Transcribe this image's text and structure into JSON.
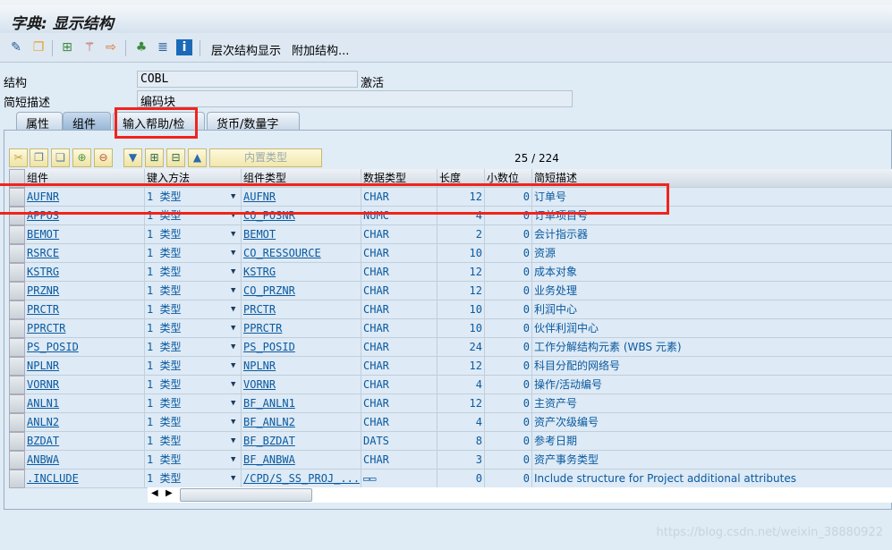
{
  "window": {
    "title": "字典: 显示结构"
  },
  "toolbar": {
    "items": [
      {
        "icon": "glasses-pencil-icon"
      },
      {
        "icon": "toggle-display-change-icon"
      },
      {
        "icon": "where-used-icon"
      },
      {
        "icon": "magic-wand-icon"
      },
      {
        "icon": "transport-icon"
      },
      {
        "icon": "hierarchy-icon"
      },
      {
        "icon": "align-icon"
      },
      {
        "icon": "info-icon"
      }
    ],
    "hierarchy_label": "层次结构显示",
    "append_label": "附加结构..."
  },
  "fields": {
    "structure_label": "结构",
    "structure_value": "COBL",
    "status": "激活",
    "desc_label": "简短描述",
    "desc_value": "编码块"
  },
  "tabs": [
    {
      "label": "属性"
    },
    {
      "label": "组件",
      "active": true
    },
    {
      "label": "输入帮助/检查"
    },
    {
      "label": "货币/数量字段"
    }
  ],
  "grid_toolbar": {
    "builtin_label": "内置类型",
    "counter": "25  /  224"
  },
  "columns": [
    "组件",
    "键入方法",
    "组件类型",
    "数据类型",
    "长度",
    "小数位",
    "简短描述"
  ],
  "rows": [
    {
      "name": "AUFNR",
      "method": "1 类型",
      "type": "AUFNR",
      "dtype": "CHAR",
      "len": "12",
      "dec": "0",
      "desc": "订单号"
    },
    {
      "name": "APPOS",
      "method": "1 类型",
      "type": "CO_POSNR",
      "dtype": "NUMC",
      "len": "4",
      "dec": "0",
      "desc": "订单项目号"
    },
    {
      "name": "BEMOT",
      "method": "1 类型",
      "type": "BEMOT",
      "dtype": "CHAR",
      "len": "2",
      "dec": "0",
      "desc": "会计指示器"
    },
    {
      "name": "RSRCE",
      "method": "1 类型",
      "type": "CO_RESSOURCE",
      "dtype": "CHAR",
      "len": "10",
      "dec": "0",
      "desc": "资源"
    },
    {
      "name": "KSTRG",
      "method": "1 类型",
      "type": "KSTRG",
      "dtype": "CHAR",
      "len": "12",
      "dec": "0",
      "desc": "成本对象"
    },
    {
      "name": "PRZNR",
      "method": "1 类型",
      "type": "CO_PRZNR",
      "dtype": "CHAR",
      "len": "12",
      "dec": "0",
      "desc": "业务处理"
    },
    {
      "name": "PRCTR",
      "method": "1 类型",
      "type": "PRCTR",
      "dtype": "CHAR",
      "len": "10",
      "dec": "0",
      "desc": "利润中心"
    },
    {
      "name": "PPRCTR",
      "method": "1 类型",
      "type": "PPRCTR",
      "dtype": "CHAR",
      "len": "10",
      "dec": "0",
      "desc": "伙伴利润中心"
    },
    {
      "name": "PS_POSID",
      "method": "1 类型",
      "type": "PS_POSID",
      "dtype": "CHAR",
      "len": "24",
      "dec": "0",
      "desc": "工作分解结构元素 (WBS 元素)"
    },
    {
      "name": "NPLNR",
      "method": "1 类型",
      "type": "NPLNR",
      "dtype": "CHAR",
      "len": "12",
      "dec": "0",
      "desc": "科目分配的网络号"
    },
    {
      "name": "VORNR",
      "method": "1 类型",
      "type": "VORNR",
      "dtype": "CHAR",
      "len": "4",
      "dec": "0",
      "desc": "操作/活动编号"
    },
    {
      "name": "ANLN1",
      "method": "1 类型",
      "type": "BF_ANLN1",
      "dtype": "CHAR",
      "len": "12",
      "dec": "0",
      "desc": "主资产号"
    },
    {
      "name": "ANLN2",
      "method": "1 类型",
      "type": "BF_ANLN2",
      "dtype": "CHAR",
      "len": "4",
      "dec": "0",
      "desc": "资产次级编号"
    },
    {
      "name": "BZDAT",
      "method": "1 类型",
      "type": "BF_BZDAT",
      "dtype": "DATS",
      "len": "8",
      "dec": "0",
      "desc": "参考日期"
    },
    {
      "name": "ANBWA",
      "method": "1 类型",
      "type": "BF_ANBWA",
      "dtype": "CHAR",
      "len": "3",
      "dec": "0",
      "desc": "资产事务类型"
    },
    {
      "name": ".INCLUDE",
      "method": "1 类型",
      "type": "/CPD/S_SS_PROJ_...",
      "dtype": "▭▭",
      "len": "0",
      "dec": "0",
      "desc": "Include structure for Project additional attributes"
    }
  ],
  "watermark": "https://blog.csdn.net/weixin_38880922",
  "colors": {
    "annotation": "#f0241c",
    "link": "#0a5aa0"
  }
}
